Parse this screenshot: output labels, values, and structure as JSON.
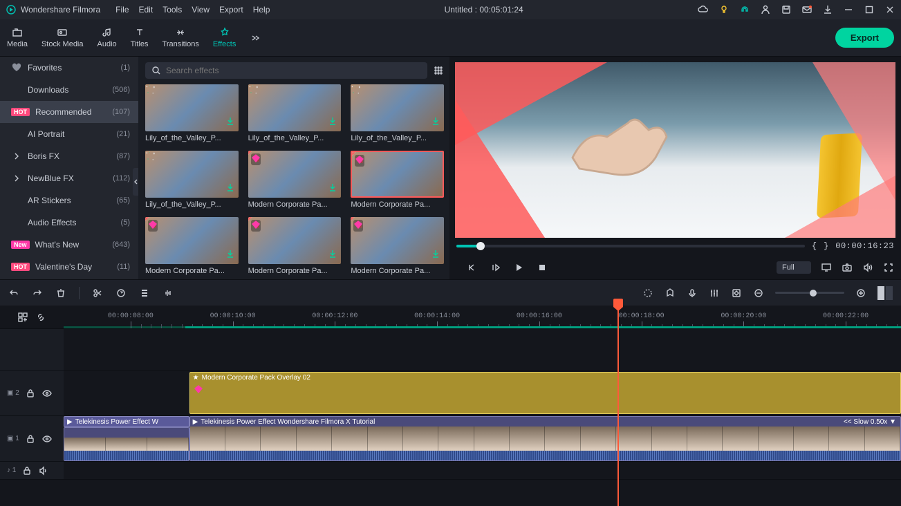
{
  "titlebar": {
    "app_name": "Wondershare Filmora",
    "menus": [
      "File",
      "Edit",
      "Tools",
      "View",
      "Export",
      "Help"
    ],
    "title": "Untitled : 00:05:01:24"
  },
  "toolbar_tabs": {
    "items": [
      {
        "label": "Media"
      },
      {
        "label": "Stock Media"
      },
      {
        "label": "Audio"
      },
      {
        "label": "Titles"
      },
      {
        "label": "Transitions"
      },
      {
        "label": "Effects",
        "active": true
      }
    ],
    "export": "Export"
  },
  "sidebar": {
    "items": [
      {
        "label": "Favorites",
        "count": "(1)",
        "icon": "heart"
      },
      {
        "label": "Downloads",
        "count": "(506)"
      },
      {
        "label": "Recommended",
        "count": "(107)",
        "badge": "HOT",
        "active": true
      },
      {
        "label": "AI Portrait",
        "count": "(21)"
      },
      {
        "label": "Boris FX",
        "count": "(87)",
        "caret": true
      },
      {
        "label": "NewBlue FX",
        "count": "(112)",
        "caret": true
      },
      {
        "label": "AR Stickers",
        "count": "(65)"
      },
      {
        "label": "Audio Effects",
        "count": "(5)"
      },
      {
        "label": "What's New",
        "count": "(643)",
        "badge": "New"
      },
      {
        "label": "Valentine's Day",
        "count": "(11)",
        "badge": "HOT"
      }
    ]
  },
  "search": {
    "placeholder": "Search effects"
  },
  "effects": [
    {
      "label": "Lily_of_the_Valley_P...",
      "dl": true
    },
    {
      "label": "Lily_of_the_Valley_P...",
      "dl": true
    },
    {
      "label": "Lily_of_the_Valley_P...",
      "dl": true
    },
    {
      "label": "Lily_of_the_Valley_P...",
      "dl": true
    },
    {
      "label": "Modern Corporate Pa...",
      "dl": true,
      "fav": true
    },
    {
      "label": "Modern Corporate Pa...",
      "sel": true,
      "fav": true
    },
    {
      "label": "Modern Corporate Pa...",
      "dl": true,
      "fav": true
    },
    {
      "label": "Modern Corporate Pa...",
      "dl": true,
      "fav": true
    },
    {
      "label": "Modern Corporate Pa...",
      "dl": true,
      "fav": true
    }
  ],
  "preview": {
    "timecode": "00:00:16:23",
    "quality": "Full"
  },
  "timeline": {
    "ruler_labels": [
      "00:00:08:00",
      "00:00:10:00",
      "00:00:12:00",
      "00:00:14:00",
      "00:00:16:00",
      "00:00:18:00",
      "00:00:20:00",
      "00:00:22:00"
    ],
    "track2_name": "▣ 2",
    "track1_name": "▣ 1",
    "audio1_name": "♪ 1",
    "clip_overlay_label": "Modern Corporate Pack Overlay 02",
    "clip_video_top_label": "Telekinesis Power Effect  W",
    "clip_video_main_label": "Telekinesis Power Effect  Wondershare Filmora X Tutorial",
    "slow_label": "<< Slow 0.50x  ▼"
  }
}
